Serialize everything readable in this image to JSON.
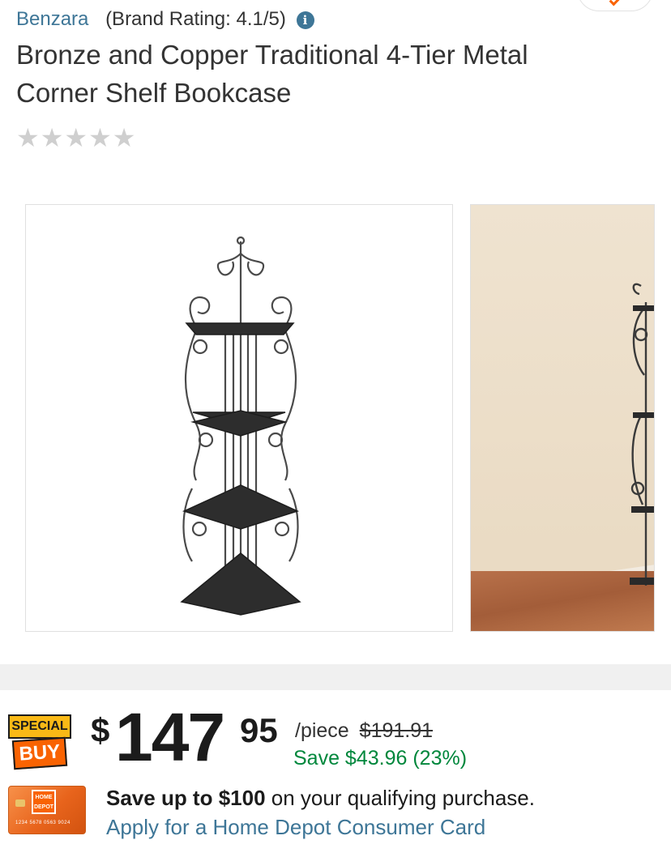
{
  "product": {
    "brand": "Benzara",
    "brand_rating": "(Brand Rating: 4.1/5)",
    "title": "Bronze and Copper Traditional 4-Tier Metal Corner Shelf Bookcase",
    "rating_stars": [
      "★",
      "★",
      "★",
      "★",
      "★"
    ],
    "star_color": "#cfcfcf"
  },
  "images": {
    "thumbnail_count": 2
  },
  "badge": {
    "top": "SPECIAL",
    "bottom": "BUY",
    "colors": {
      "top": "#f9b916",
      "bottom": "#f96302"
    }
  },
  "pricing": {
    "currency": "$",
    "dollars": "147",
    "cents": "95",
    "unit": "/piece",
    "was_price": "$191.91",
    "savings": "Save $43.96 (23%)",
    "savings_color": "#00873c"
  },
  "promo": {
    "bold": "Save up to $100",
    "rest": " on your qualifying purchase.",
    "link": "Apply for a Home Depot Consumer Card",
    "card_logo": "HOME DEPOT",
    "card_number": "1234 5678 0563 9024",
    "link_color": "#3e7697"
  }
}
